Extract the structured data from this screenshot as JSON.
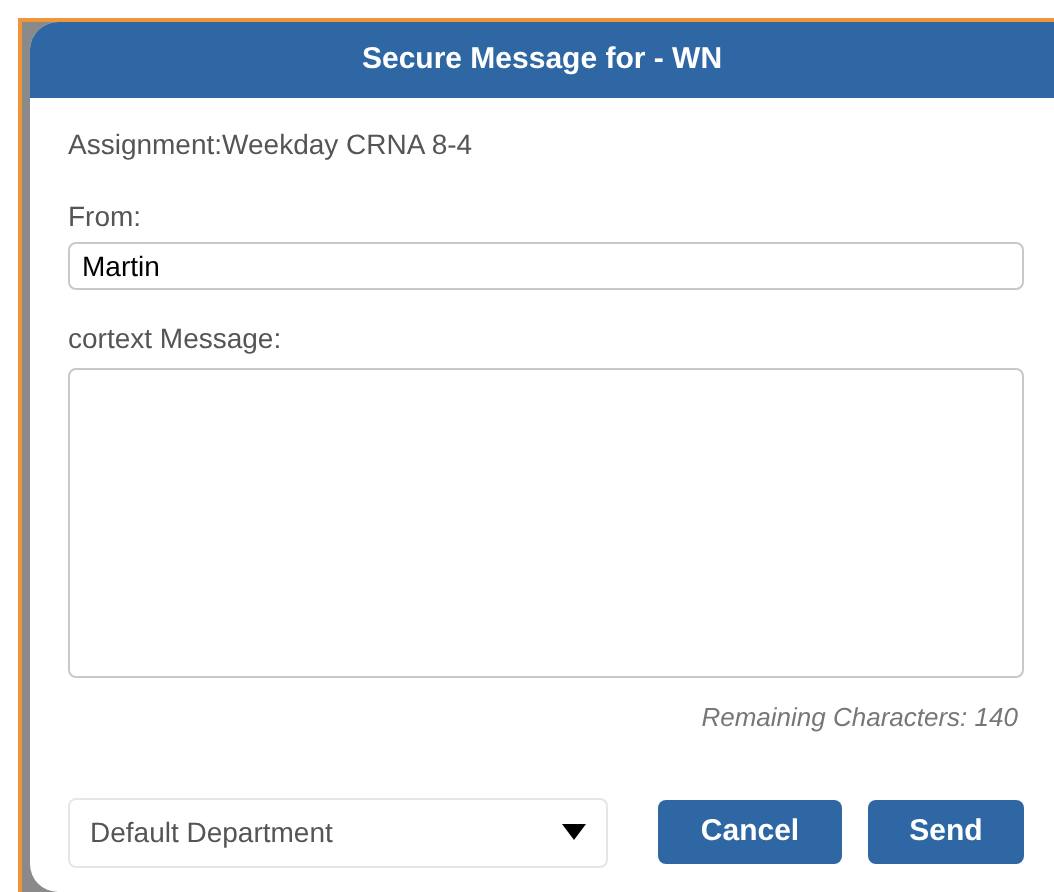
{
  "dialog": {
    "title": "Secure Message for - WN"
  },
  "assignment": "Assignment:Weekday CRNA 8-4",
  "from": {
    "label": "From:",
    "value": "Martin"
  },
  "message": {
    "label": "cortext Message:"
  },
  "remaining": {
    "label": "Remaining Characters:",
    "count": "140"
  },
  "department": {
    "value": "Default Department"
  },
  "buttons": [
    "Cancel",
    "Send"
  ]
}
